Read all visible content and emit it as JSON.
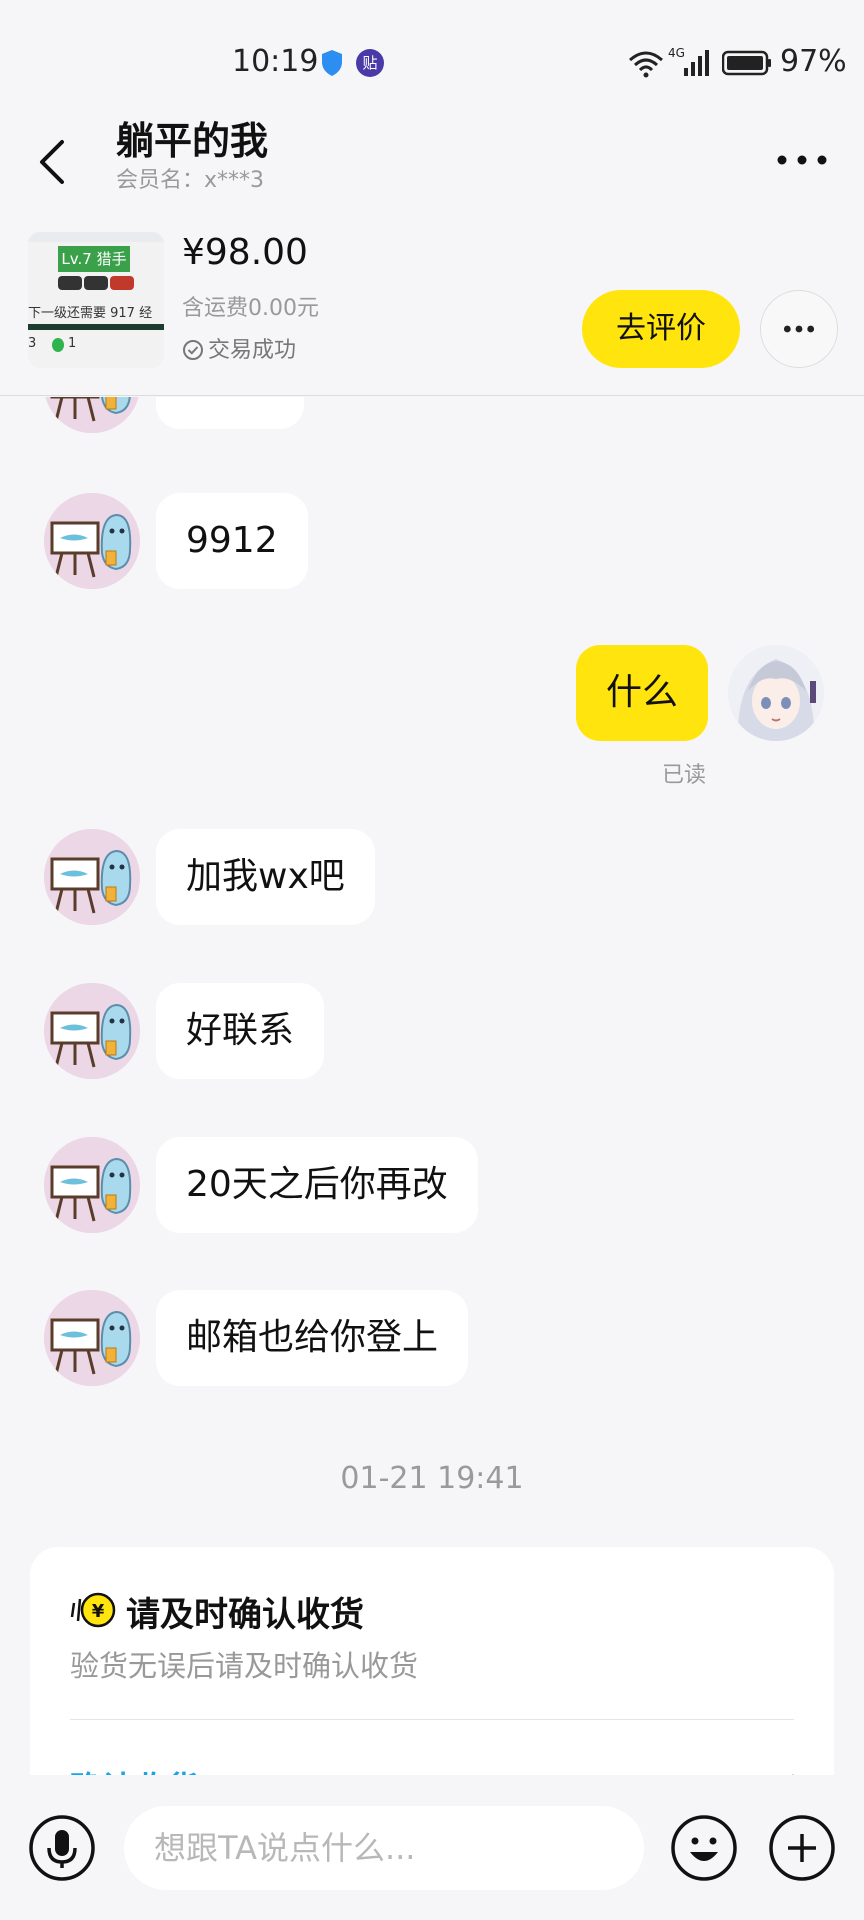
{
  "status_bar": {
    "time": "10:19",
    "tie_badge": "贴",
    "network": "4G",
    "battery": "97%"
  },
  "header": {
    "title": "躺平的我",
    "member_label": "会员名：x***3"
  },
  "product": {
    "thumbnail": {
      "level_badge": "Lv.7 猎手",
      "level_text": "下一级还需要 917 经",
      "stat_count": "3",
      "gem_count": "1"
    },
    "price": "¥98.00",
    "shipping": "含运费0.00元",
    "deal_status": "交易成功",
    "review_button": "去评价"
  },
  "messages": [
    {
      "sender": "other",
      "text": ""
    },
    {
      "sender": "other",
      "text": "9912"
    },
    {
      "sender": "me",
      "text": "什么",
      "status": "已读"
    },
    {
      "sender": "other",
      "text": "加我wx吧"
    },
    {
      "sender": "other",
      "text": "好联系"
    },
    {
      "sender": "other",
      "text": "20天之后你再改"
    },
    {
      "sender": "other",
      "text": "邮箱也给你登上"
    }
  ],
  "timestamp": "01-21 19:41",
  "system_card": {
    "title": "请及时确认收货",
    "description": "验货无误后请及时确认收货",
    "action": "确认收货"
  },
  "input": {
    "placeholder": "想跟TA说点什么..."
  },
  "colors": {
    "accent_yellow": "#ffe40e",
    "link_blue": "#1aa4e6",
    "background": "#f6f6f8"
  },
  "icons": [
    "back-arrow-icon",
    "more-icon",
    "check-circle-icon",
    "yuan-coin-icon",
    "microphone-icon",
    "emoji-icon",
    "plus-icon",
    "shield-icon",
    "wifi-icon",
    "signal-icon",
    "battery-icon"
  ]
}
